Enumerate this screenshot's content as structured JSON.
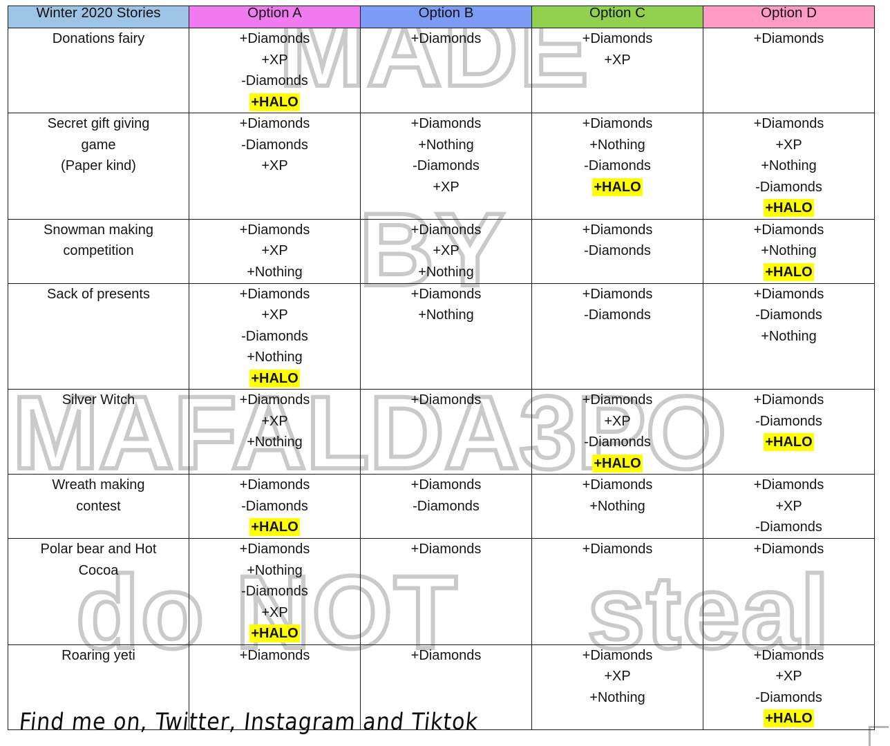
{
  "table": {
    "headers": [
      {
        "label": "Winter 2020 Stories",
        "color": "#9DC3E6"
      },
      {
        "label": "Option A",
        "color": "#F07AF0"
      },
      {
        "label": "Option B",
        "color": "#7B9BF5"
      },
      {
        "label": "Option C",
        "color": "#92D050"
      },
      {
        "label": "Option D",
        "color": "#FF9BC4"
      }
    ],
    "rows": [
      {
        "story": "Donations fairy",
        "option_a": [
          "+Diamonds",
          "+XP",
          "-Diamonds",
          "+HALO"
        ],
        "option_a_halo": [
          false,
          false,
          false,
          true
        ],
        "option_b": [
          "+Diamonds"
        ],
        "option_b_halo": [
          false
        ],
        "option_c": [
          "+Diamonds",
          "+XP"
        ],
        "option_c_halo": [
          false,
          false
        ],
        "option_d": [
          "+Diamonds"
        ],
        "option_d_halo": [
          false
        ]
      },
      {
        "story": "Secret gift giving\ngame\n(Paper kind)",
        "option_a": [
          "+Diamonds",
          "-Diamonds",
          "+XP"
        ],
        "option_a_halo": [
          false,
          false,
          false
        ],
        "option_b": [
          "+Diamonds",
          "+Nothing",
          "-Diamonds",
          "+XP"
        ],
        "option_b_halo": [
          false,
          false,
          false,
          false
        ],
        "option_c": [
          "+Diamonds",
          "+Nothing",
          "-Diamonds",
          "+HALO"
        ],
        "option_c_halo": [
          false,
          false,
          false,
          true
        ],
        "option_d": [
          "+Diamonds",
          "+XP",
          "+Nothing",
          "-Diamonds",
          "+HALO"
        ],
        "option_d_halo": [
          false,
          false,
          false,
          false,
          true
        ]
      },
      {
        "story": "Snowman making\ncompetition",
        "option_a": [
          "+Diamonds",
          "+XP",
          "+Nothing"
        ],
        "option_a_halo": [
          false,
          false,
          false
        ],
        "option_b": [
          "+Diamonds",
          "+XP",
          "+Nothing"
        ],
        "option_b_halo": [
          false,
          false,
          false
        ],
        "option_c": [
          "+Diamonds",
          "-Diamonds"
        ],
        "option_c_halo": [
          false,
          false
        ],
        "option_d": [
          "+Diamonds",
          "+Nothing",
          "+HALO"
        ],
        "option_d_halo": [
          false,
          false,
          true
        ]
      },
      {
        "story": "Sack of presents",
        "option_a": [
          "+Diamonds",
          "+XP",
          "-Diamonds",
          "+Nothing",
          "+HALO"
        ],
        "option_a_halo": [
          false,
          false,
          false,
          false,
          true
        ],
        "option_b": [
          "+Diamonds",
          "+Nothing"
        ],
        "option_b_halo": [
          false,
          false
        ],
        "option_c": [
          "+Diamonds",
          "-Diamonds"
        ],
        "option_c_halo": [
          false,
          false
        ],
        "option_d": [
          "+Diamonds",
          "-Diamonds",
          "+Nothing"
        ],
        "option_d_halo": [
          false,
          false,
          false
        ]
      },
      {
        "story": "Silver Witch",
        "option_a": [
          "+Diamonds",
          "+XP",
          "+Nothing"
        ],
        "option_a_halo": [
          false,
          false,
          false
        ],
        "option_b": [
          "+Diamonds"
        ],
        "option_b_halo": [
          false
        ],
        "option_c": [
          "+Diamonds",
          "+XP",
          "-Diamonds",
          "+HALO"
        ],
        "option_c_halo": [
          false,
          false,
          false,
          true
        ],
        "option_d": [
          "+Diamonds",
          "-Diamonds",
          "+HALO"
        ],
        "option_d_halo": [
          false,
          false,
          true
        ]
      },
      {
        "story": "Wreath making\ncontest",
        "option_a": [
          "+Diamonds",
          "-Diamonds",
          "+HALO"
        ],
        "option_a_halo": [
          false,
          false,
          true
        ],
        "option_b": [
          "+Diamonds",
          "-Diamonds"
        ],
        "option_b_halo": [
          false,
          false
        ],
        "option_c": [
          "+Diamonds",
          "+Nothing"
        ],
        "option_c_halo": [
          false,
          false
        ],
        "option_d": [
          "+Diamonds",
          "+XP",
          "-Diamonds"
        ],
        "option_d_halo": [
          false,
          false,
          false
        ]
      },
      {
        "story": "Polar bear and Hot\nCocoa",
        "option_a": [
          "+Diamonds",
          "+Nothing",
          "-Diamonds",
          "+XP",
          "+HALO"
        ],
        "option_a_halo": [
          false,
          false,
          false,
          false,
          true
        ],
        "option_b": [
          "+Diamonds"
        ],
        "option_b_halo": [
          false
        ],
        "option_c": [
          "+Diamonds"
        ],
        "option_c_halo": [
          false
        ],
        "option_d": [
          "+Diamonds"
        ],
        "option_d_halo": [
          false
        ]
      },
      {
        "story": "Roaring yeti",
        "option_a": [
          "+Diamonds"
        ],
        "option_a_halo": [
          false
        ],
        "option_b": [
          "+Diamonds"
        ],
        "option_b_halo": [
          false
        ],
        "option_c": [
          "+Diamonds",
          "+XP",
          "+Nothing"
        ],
        "option_c_halo": [
          false,
          false,
          false
        ],
        "option_d": [
          "+Diamonds",
          "+XP",
          "-Diamonds",
          "+HALO"
        ],
        "option_d_halo": [
          false,
          false,
          false,
          true
        ]
      }
    ]
  },
  "watermark": {
    "line1": "MADE",
    "line2": "BY",
    "line3": "MAFALDA3PO",
    "line4": "do NOT",
    "line5": "steal",
    "color": "#AAAAAA"
  },
  "footer": {
    "note": "Find me on, Twitter, Instagram and Tiktok"
  },
  "colors": {
    "highlight": "#FFFF00",
    "border": "#1A1A1A",
    "background": "#FFFFFF"
  }
}
